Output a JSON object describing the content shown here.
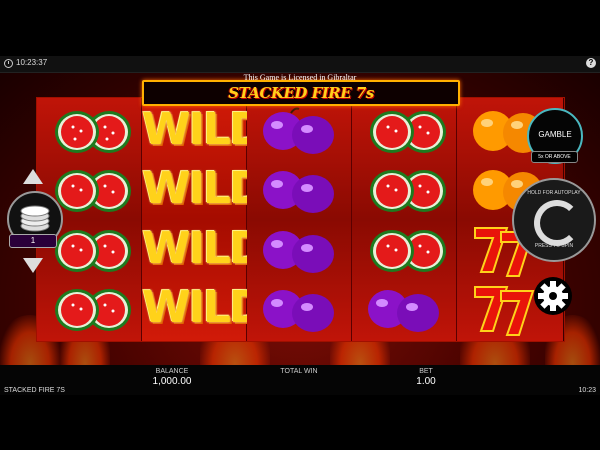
{
  "status_bar": {
    "time": "10:23:37"
  },
  "license_text": "This Game is Licensed in Gibraltar",
  "logo": {
    "text": "STACKED FIRE 7s"
  },
  "reels": [
    {
      "symbol": "watermelon"
    },
    {
      "symbol": "wild",
      "wild_label": "WILD"
    },
    {
      "symbol": "plum"
    },
    {
      "symbol": "watermelon"
    },
    {
      "symbol": "mixed",
      "stack": [
        "orange",
        "orange",
        "seven",
        "seven"
      ]
    }
  ],
  "controls": {
    "gamble_label": "GAMBLE",
    "gamble_sub": "5x OR ABOVE",
    "autoplay_text": "HOLD FOR AUTOPLAY",
    "spin_text": "PRESS TO SPIN",
    "bet_level": "1"
  },
  "footer": {
    "game_name": "STACKED FIRE 7S",
    "balance_label": "BALANCE",
    "balance_value": "1,000.00",
    "total_win_label": "TOTAL WIN",
    "total_win_value": "",
    "bet_label": "BET",
    "bet_value": "1.00",
    "time": "10:23"
  },
  "colors": {
    "reel_red": "#c01408",
    "wild_yellow": "#ffd21a",
    "gamble_ring": "#4ab8c0",
    "plum_purple": "#8b12c8"
  }
}
